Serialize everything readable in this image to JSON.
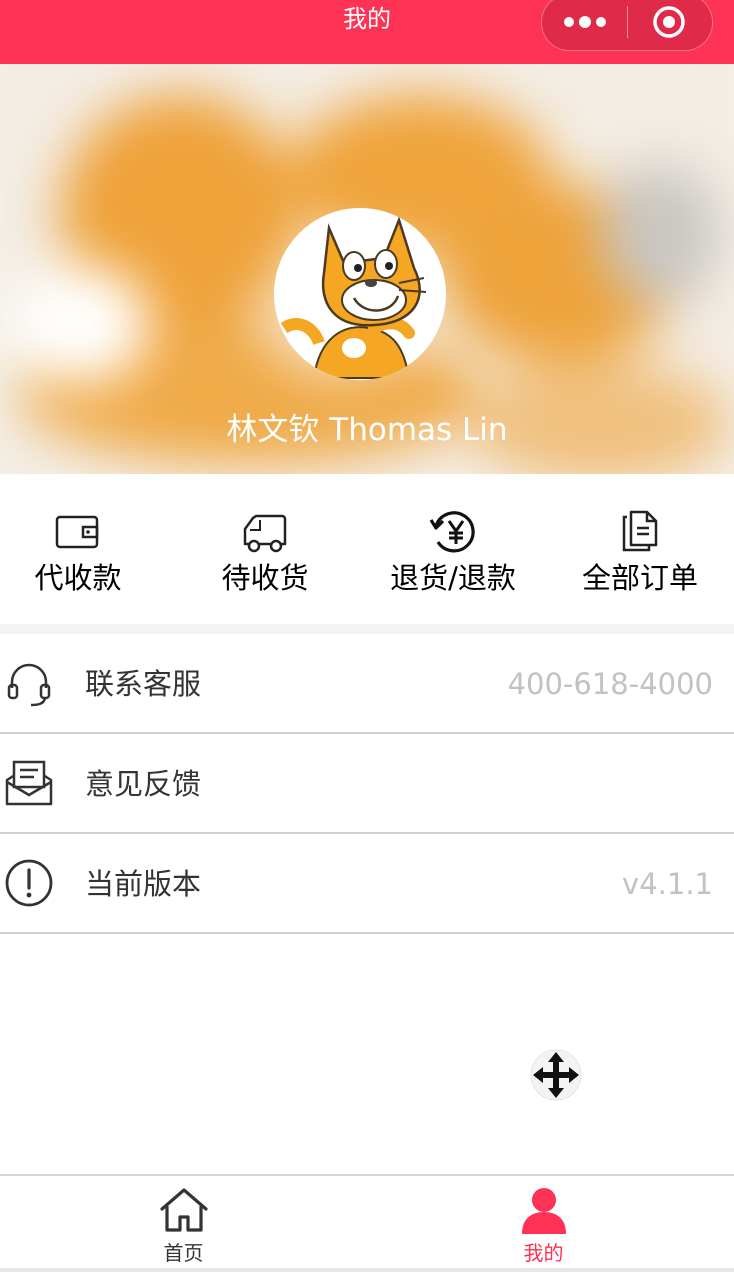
{
  "navbar": {
    "title": "我的",
    "background": "#fe3254",
    "capsule_icons": [
      "more-dots-icon",
      "target-icon"
    ]
  },
  "profile": {
    "name": "林文钦 Thomas Lin",
    "avatar_icon": "cartoon-cat-avatar"
  },
  "orders": [
    {
      "label": "代收款",
      "icon": "wallet-icon"
    },
    {
      "label": "待收货",
      "icon": "truck-icon"
    },
    {
      "label": "退货/退款",
      "icon": "refund-yen-icon"
    },
    {
      "label": "全部订单",
      "icon": "documents-icon"
    }
  ],
  "menu": [
    {
      "label": "联系客服",
      "value": "400-618-4000",
      "icon": "headset-icon"
    },
    {
      "label": "意见反馈",
      "value": "",
      "icon": "envelope-icon"
    },
    {
      "label": "当前版本",
      "value": "v4.1.1",
      "icon": "exclamation-circle-icon"
    }
  ],
  "tabbar": {
    "tabs": [
      {
        "label": "首页",
        "icon": "home-icon",
        "active": false
      },
      {
        "label": "我的",
        "icon": "person-icon",
        "active": true
      }
    ],
    "active_color": "#fe3254",
    "inactive_color": "#333333"
  }
}
